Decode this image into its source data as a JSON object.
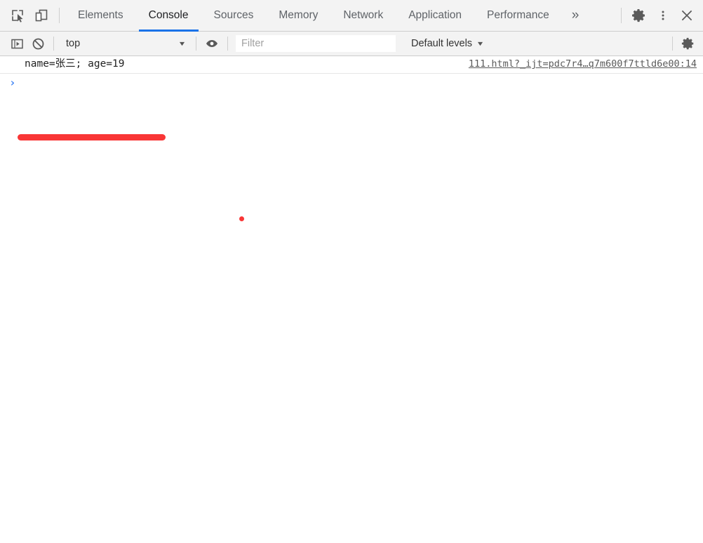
{
  "toolbar": {
    "inspect_icon": "inspect-element-icon",
    "device_icon": "device-toolbar-icon",
    "tabs": [
      {
        "label": "Elements",
        "active": false
      },
      {
        "label": "Console",
        "active": true
      },
      {
        "label": "Sources",
        "active": false
      },
      {
        "label": "Memory",
        "active": false
      },
      {
        "label": "Network",
        "active": false
      },
      {
        "label": "Application",
        "active": false
      },
      {
        "label": "Performance",
        "active": false
      }
    ],
    "more_tabs_label": "»",
    "settings_icon": "gear-icon",
    "menu_icon": "more-vertical-icon",
    "close_icon": "close-icon",
    "accent_color": "#1a73e8"
  },
  "filterbar": {
    "sidebar_toggle_icon": "console-sidebar-icon",
    "clear_icon": "clear-console-icon",
    "context_value": "top",
    "context_caret": "▼",
    "eye_icon": "live-expression-icon",
    "filter_placeholder": "Filter",
    "filter_value": "",
    "levels_label": "Default levels",
    "levels_caret": "▼",
    "settings_icon": "console-settings-gear-icon"
  },
  "console": {
    "messages": [
      {
        "text": "name=张三; age=19",
        "source": "111.html?_ijt=pdc7r4…q7m600f7ttld6e00:14"
      }
    ],
    "prompt_caret": "›",
    "prompt_value": ""
  },
  "annotations": {
    "stroke_color": "#f93636",
    "dot_color": "#f93636"
  }
}
